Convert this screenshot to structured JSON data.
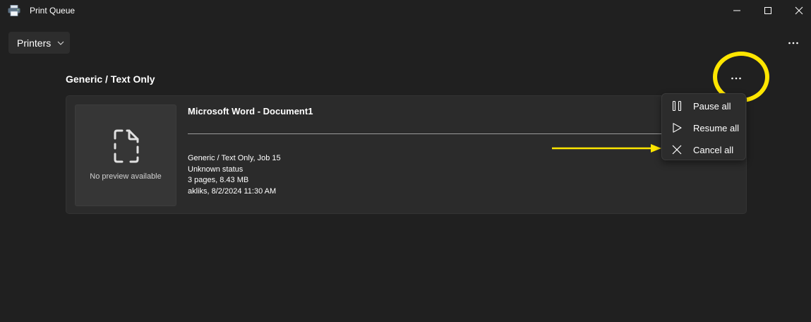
{
  "window": {
    "title": "Print Queue",
    "icon": "printer-icon"
  },
  "toolbar": {
    "printers_label": "Printers",
    "more_icon": "more-icon"
  },
  "printer": {
    "name": "Generic / Text Only"
  },
  "job": {
    "document_title": "Microsoft Word - Document1",
    "preview_text": "No preview available",
    "details": [
      "Generic / Text Only, Job 15",
      "Unknown status",
      "3 pages, 8.43 MB",
      "akliks, 8/2/2024 11:30 AM"
    ]
  },
  "menu": {
    "items": [
      {
        "label": "Pause all",
        "icon": "pause-icon"
      },
      {
        "label": "Resume all",
        "icon": "play-icon"
      },
      {
        "label": "Cancel all",
        "icon": "close-icon"
      }
    ]
  },
  "colors": {
    "background": "#202020",
    "card": "#2b2b2b",
    "menu": "#2c2c2c",
    "highlight": "#ffe600"
  }
}
